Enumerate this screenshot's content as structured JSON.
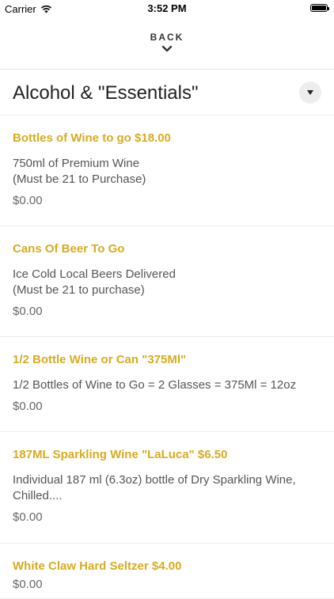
{
  "status_bar": {
    "carrier": "Carrier",
    "time": "3:52 PM"
  },
  "nav": {
    "back_label": "BACK"
  },
  "section": {
    "title": "Alcohol & \"Essentials\""
  },
  "items": [
    {
      "name": "Bottles of Wine to go  $18.00",
      "desc_lines": [
        "750ml of Premium Wine",
        "(Must be 21 to Purchase)"
      ],
      "price": "$0.00"
    },
    {
      "name": "Cans Of Beer To Go",
      "desc_lines": [
        "Ice Cold Local Beers Delivered",
        "(Must be 21 to purchase)"
      ],
      "price": "$0.00"
    },
    {
      "name": "1/2 Bottle Wine  or Can \"375Ml\"",
      "desc_lines": [
        "1/2 Bottles of Wine to Go = 2 Glasses = 375Ml = 12oz"
      ],
      "price": "$0.00"
    },
    {
      "name": "187ML Sparkling Wine \"LaLuca\" $6.50",
      "desc_lines": [
        "Individual 187 ml (6.3oz) bottle of Dry Sparkling Wine,",
        "Chilled...."
      ],
      "price": "$0.00"
    },
    {
      "name": "White Claw Hard Seltzer $4.00",
      "desc_lines": [],
      "price": "$0.00"
    }
  ],
  "colors": {
    "accent": "#d7ab22",
    "divider": "#ececec"
  },
  "icons": {
    "wifi": "wifi-icon",
    "battery": "battery-icon",
    "chevron": "chevron-down-icon"
  }
}
